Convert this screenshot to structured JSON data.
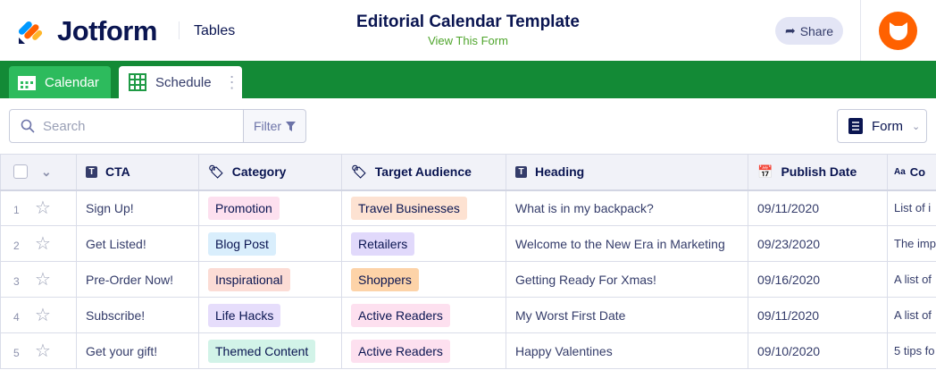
{
  "header": {
    "brand": "Jotform",
    "section": "Tables",
    "title": "Editorial Calendar Template",
    "subtitle_link": "View This Form",
    "share_label": "Share"
  },
  "tabs": [
    {
      "label": "Calendar",
      "icon": "calendar-icon"
    },
    {
      "label": "Schedule",
      "icon": "grid-icon"
    }
  ],
  "toolbar": {
    "search_placeholder": "Search",
    "search_value": "",
    "filter_label": "Filter",
    "form_label": "Form"
  },
  "columns": [
    "CTA",
    "Category",
    "Target Audience",
    "Heading",
    "Publish Date",
    "Co"
  ],
  "rows": [
    {
      "n": "1",
      "cta": "Sign Up!",
      "category": "Promotion",
      "target": "Travel Businesses",
      "heading": "What is in my backpack?",
      "date": "09/11/2020",
      "content": "List of i"
    },
    {
      "n": "2",
      "cta": "Get Listed!",
      "category": "Blog Post",
      "target": "Retailers",
      "heading": "Welcome to the New Era in Marketing",
      "date": "09/23/2020",
      "content": "The imp"
    },
    {
      "n": "3",
      "cta": "Pre-Order Now!",
      "category": "Inspirational",
      "target": "Shoppers",
      "heading": "Getting Ready For Xmas!",
      "date": "09/16/2020",
      "content": "A list of"
    },
    {
      "n": "4",
      "cta": "Subscribe!",
      "category": "Life Hacks",
      "target": "Active Readers",
      "heading": "My Worst First Date",
      "date": "09/11/2020",
      "content": "A list of"
    },
    {
      "n": "5",
      "cta": "Get your gift!",
      "category": "Themed Content",
      "target": "Active Readers",
      "heading": "Happy Valentines",
      "date": "09/10/2020",
      "content": "5 tips fo"
    }
  ],
  "colors": {
    "green": "#138a36",
    "tab_green": "#2dbb5d",
    "accent_orange": "#ff6100",
    "navy": "#0a1551",
    "tags": {
      "Promotion": "#fde0ef",
      "Blog Post": "#d9eefc",
      "Inspirational": "#fcdcd5",
      "Life Hacks": "#e6ddfb",
      "Themed Content": "#d2f3e8",
      "Travel Businesses": "#fde2d2",
      "Retailers": "#e1d9fb",
      "Shoppers": "#fdd3a8",
      "Active Readers": "#fde0ef"
    }
  }
}
